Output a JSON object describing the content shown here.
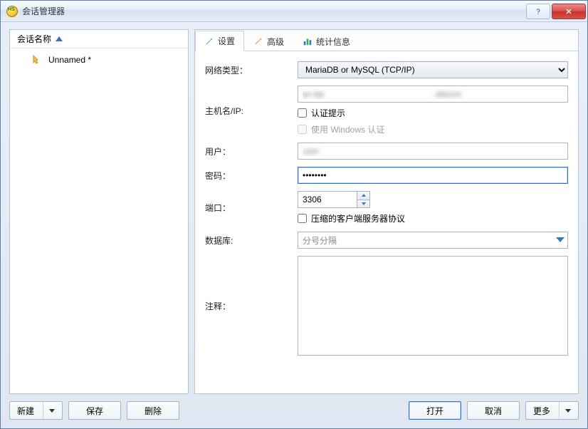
{
  "window": {
    "title": "会话管理器"
  },
  "left": {
    "header": "会话名称",
    "sessions": [
      {
        "name": "Unnamed *"
      }
    ]
  },
  "tabs": {
    "settings": "设置",
    "advanced": "高级",
    "stats": "统计信息"
  },
  "form": {
    "netType": {
      "label": "网络类型：",
      "value": "MariaDB or MySQL (TCP/IP)"
    },
    "host": {
      "label": "主机名/IP:",
      "value": "pc-bp                                              .aliyunc"
    },
    "authPrompt": {
      "label": "认证提示"
    },
    "winAuth": {
      "label": "使用 Windows 认证"
    },
    "user": {
      "label": "用户：",
      "value": "user"
    },
    "password": {
      "label": "密码：",
      "value": "••••••••"
    },
    "port": {
      "label": "端口：",
      "value": "3306"
    },
    "compress": {
      "label": "压缩的客户端服务器协议"
    },
    "database": {
      "label": "数据库:",
      "placeholder": "分号分隔"
    },
    "notes": {
      "label": "注释：",
      "value": ""
    }
  },
  "buttons": {
    "new": "新建",
    "save": "保存",
    "delete": "删除",
    "open": "打开",
    "cancel": "取消",
    "more": "更多"
  }
}
